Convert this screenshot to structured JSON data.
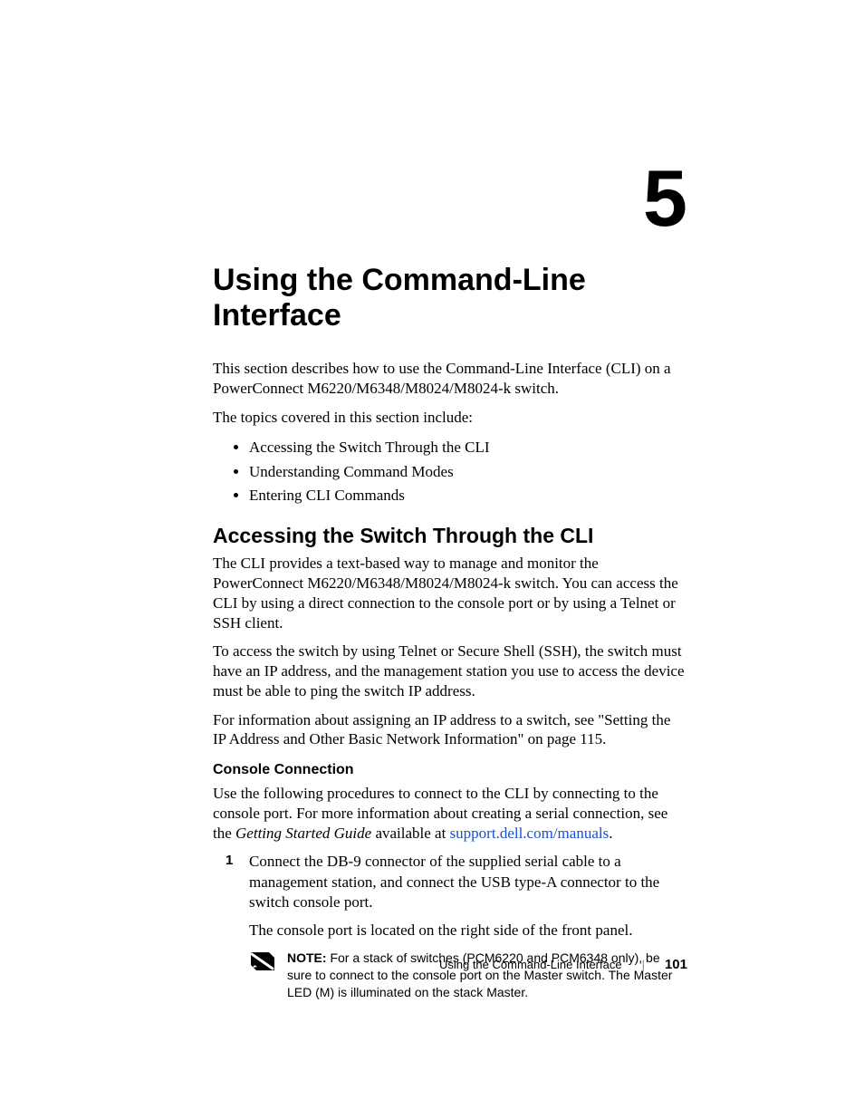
{
  "chapter_number": "5",
  "chapter_title": "Using the Command-Line Interface",
  "intro_1": "This section describes how to use the Command-Line Interface (CLI) on a PowerConnect M6220/M6348/M8024/M8024-k switch.",
  "intro_2": "The topics covered in this section include:",
  "topics": [
    "Accessing the Switch Through the CLI",
    "Understanding Command Modes",
    "Entering CLI Commands"
  ],
  "section1_title": "Accessing the Switch Through the CLI",
  "section1_p1": "The CLI provides a text-based way to manage and monitor the PowerConnect M6220/M6348/M8024/M8024-k switch. You can access the CLI by using a direct connection to the console port or by using a Telnet or SSH client.",
  "section1_p2": "To access the switch by using Telnet or Secure Shell (SSH), the switch must have an IP address, and the management station you use to access the device must be able to ping the switch IP address.",
  "section1_p3": "For information about assigning an IP address to a switch, see \"Setting the IP Address and Other Basic Network Information\" on page 115.",
  "subsection_title": "Console Connection",
  "subsection_p1_a": "Use the following procedures to connect to the CLI by connecting to the console port. For more information about creating a serial connection, see the ",
  "subsection_p1_guide": "Getting Started Guide",
  "subsection_p1_b": " available at ",
  "subsection_link_text": "support.dell.com/manuals",
  "subsection_p1_c": ".",
  "step1_a": "Connect the DB-9 connector of the supplied serial cable to a management station, and connect the USB type-A connector to the switch console port.",
  "step1_b": "The console port is located on the right side of the front panel.",
  "note_label": "NOTE:",
  "note_text": " For a stack of switches (PCM6220 and PCM6348 only), be sure to connect to the console port on the Master switch. The Master LED (M) is illuminated on the stack Master.",
  "footer_title": "Using the Command-Line Interface",
  "footer_page": "101"
}
